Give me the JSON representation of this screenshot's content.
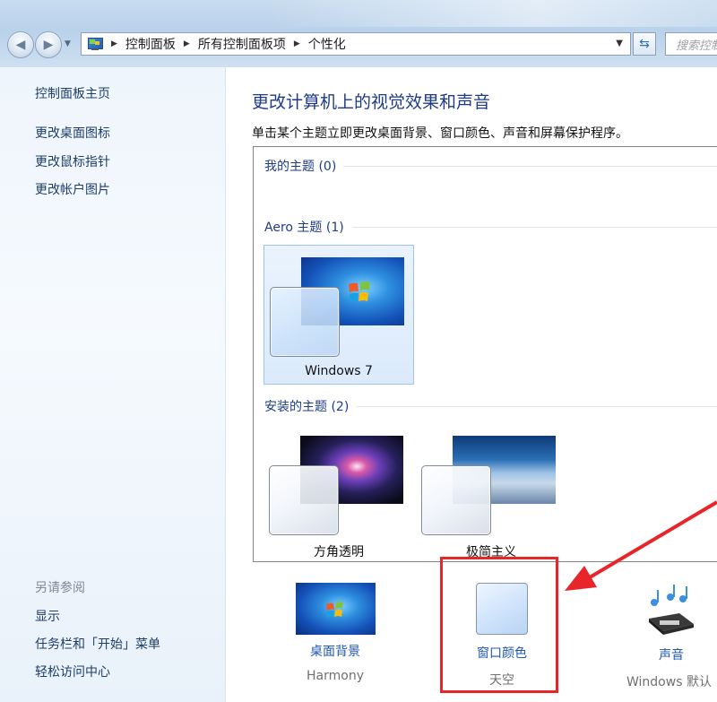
{
  "breadcrumb": [
    "控制面板",
    "所有控制面板项",
    "个性化"
  ],
  "search": {
    "placeholder": "搜索控制"
  },
  "sidebar": {
    "home": "控制面板主页",
    "links": [
      "更改桌面图标",
      "更改鼠标指针",
      "更改帐户图片"
    ],
    "see_also_title": "另请参阅",
    "see_also": [
      "显示",
      "任务栏和「开始」菜单",
      "轻松访问中心"
    ]
  },
  "main": {
    "heading": "更改计算机上的视觉效果和声音",
    "description": "单击某个主题立即更改桌面背景、窗口颜色、声音和屏幕保护程序。",
    "groups": {
      "my_themes": "我的主题 (0)",
      "aero_themes": "Aero 主题 (1)",
      "installed_themes": "安装的主题 (2)"
    },
    "themes": {
      "windows7": "Windows 7",
      "fangjiao": "方角透明",
      "jijian": "极简主义"
    }
  },
  "bottom": {
    "desktop_background": {
      "label": "桌面背景",
      "value": "Harmony"
    },
    "window_color": {
      "label": "窗口颜色",
      "value": "天空"
    },
    "sounds": {
      "label": "声音",
      "value": "Windows 默认"
    }
  },
  "colors": {
    "link": "#1e57b3",
    "heading": "#1e3b87",
    "highlight": "#e8262a"
  }
}
